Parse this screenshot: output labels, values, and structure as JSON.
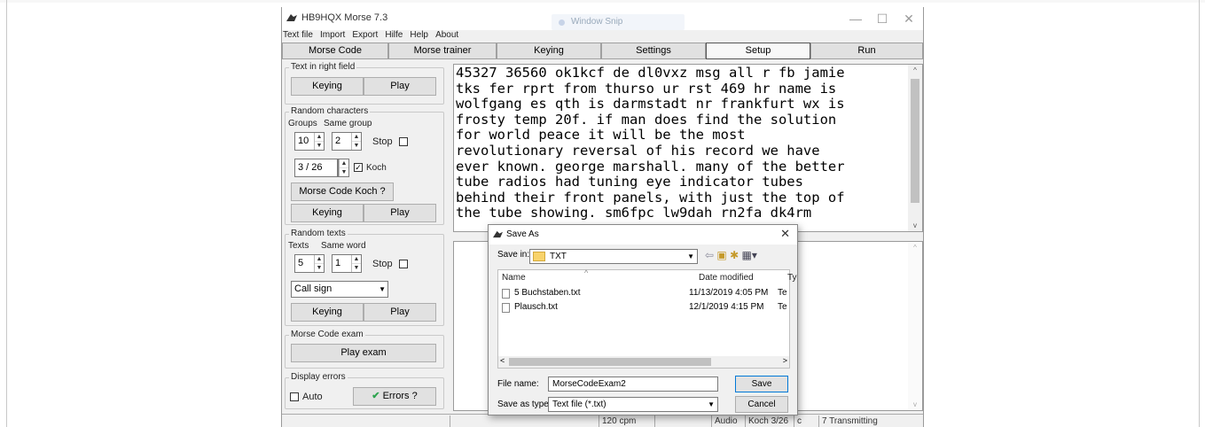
{
  "window": {
    "title": "HB9HQX Morse 7.3",
    "ghost_snip": "Window Snip",
    "controls": {
      "minimize": "—",
      "maximize": "☐",
      "close": "✕"
    }
  },
  "menu": [
    "Text file",
    "Import",
    "Export",
    "Hilfe",
    "Help",
    "About"
  ],
  "tabs": [
    {
      "label": "Morse Code"
    },
    {
      "label": "Morse trainer"
    },
    {
      "label": "Keying"
    },
    {
      "label": "Settings"
    },
    {
      "label": "Setup"
    },
    {
      "label": "Run"
    }
  ],
  "left": {
    "text_in_right": {
      "title": "Text in right field",
      "keying": "Keying",
      "play": "Play"
    },
    "random_chars": {
      "title": "Random characters",
      "groups_label": "Groups",
      "same_group_label": "Same group",
      "groups_value": "10",
      "same_group_value": "2",
      "stop_label": "Stop",
      "koch_value": "3 / 26",
      "koch_label": "Koch",
      "koch_button": "Morse Code Koch ?",
      "keying": "Keying",
      "play": "Play"
    },
    "random_texts": {
      "title": "Random texts",
      "texts_label": "Texts",
      "same_word_label": "Same word",
      "texts_value": "5",
      "same_word_value": "1",
      "stop_label": "Stop",
      "combo_value": "Call sign",
      "keying": "Keying",
      "play": "Play"
    },
    "exam": {
      "title": "Morse Code exam",
      "play": "Play exam"
    },
    "errors": {
      "title": "Display errors",
      "auto": "Auto",
      "errors_button": "Errors ?"
    }
  },
  "main_text": "45327 36560 ok1kcf de dl0vxz msg all r fb jamie\ntks fer rprt from thurso ur rst 469 hr name is\nwolfgang es qth is darmstadt nr frankfurt wx is\nfrosty temp 20f. if man does find the solution\nfor world peace it will be the most\nrevolutionary reversal of his record we have\never known. george marshall. many of the better\ntube radios had tuning eye indicator tubes\nbehind their front panels, with just the top of\nthe tube showing. sm6fpc lw9dah rn2fa dk4rm",
  "statusbar": {
    "speed": "120 cpm",
    "audio": "Audio",
    "koch": "Koch 3/26",
    "c": "c",
    "transmitting": "7 Transmitting"
  },
  "dialog": {
    "title": "Save As",
    "save_in_label": "Save in:",
    "folder": "TXT",
    "columns": {
      "name": "Name",
      "date": "Date modified",
      "type": "Ty"
    },
    "files": [
      {
        "name": "5 Buchstaben.txt",
        "date": "11/13/2019 4:05 PM",
        "type": "Te"
      },
      {
        "name": "Plausch.txt",
        "date": "12/1/2019 4:15 PM",
        "type": "Te"
      }
    ],
    "filename_label": "File name:",
    "filename_value": "MorseCodeExam2",
    "save_type_label": "Save as type:",
    "save_type_value": "Text file (*.txt)",
    "save_button": "Save",
    "cancel_button": "Cancel"
  },
  "colors": {
    "accent": "#0078d7",
    "checkmark": "#2ea44f",
    "folder": "#f8d36b"
  }
}
